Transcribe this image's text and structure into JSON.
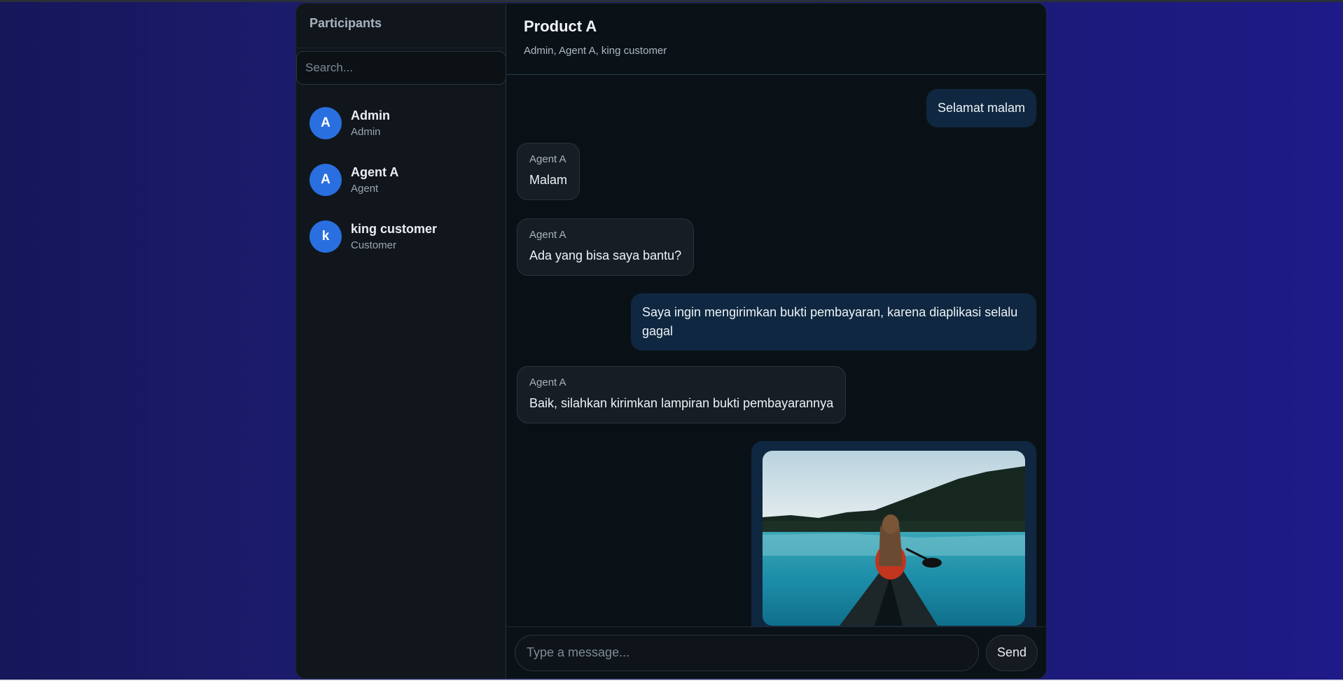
{
  "sidebar": {
    "title": "Participants",
    "search_placeholder": "Search...",
    "participants": [
      {
        "initial": "A",
        "name": "Admin",
        "role": "Admin"
      },
      {
        "initial": "A",
        "name": "Agent A",
        "role": "Agent"
      },
      {
        "initial": "k",
        "name": "king customer",
        "role": "Customer"
      }
    ]
  },
  "chat": {
    "title": "Product A",
    "members": "Admin, Agent A, king customer",
    "messages": [
      {
        "direction": "out",
        "text": "Selamat malam"
      },
      {
        "direction": "in",
        "sender": "Agent A",
        "text": "Malam"
      },
      {
        "direction": "in",
        "sender": "Agent A",
        "text": "Ada yang bisa saya bantu?"
      },
      {
        "direction": "out",
        "text": "Saya ingin mengirimkan bukti pembayaran, karena diaplikasi selalu gagal"
      },
      {
        "direction": "in",
        "sender": "Agent A",
        "text": "Baik, silahkan kirimkan lampiran bukti pembayarannya"
      },
      {
        "direction": "out",
        "type": "image"
      }
    ]
  },
  "composer": {
    "placeholder": "Type a message...",
    "send_label": "Send"
  },
  "colors": {
    "accent": "#2a6fe0",
    "outgoing_bubble": "#0f2740",
    "incoming_bubble": "#161d24"
  }
}
